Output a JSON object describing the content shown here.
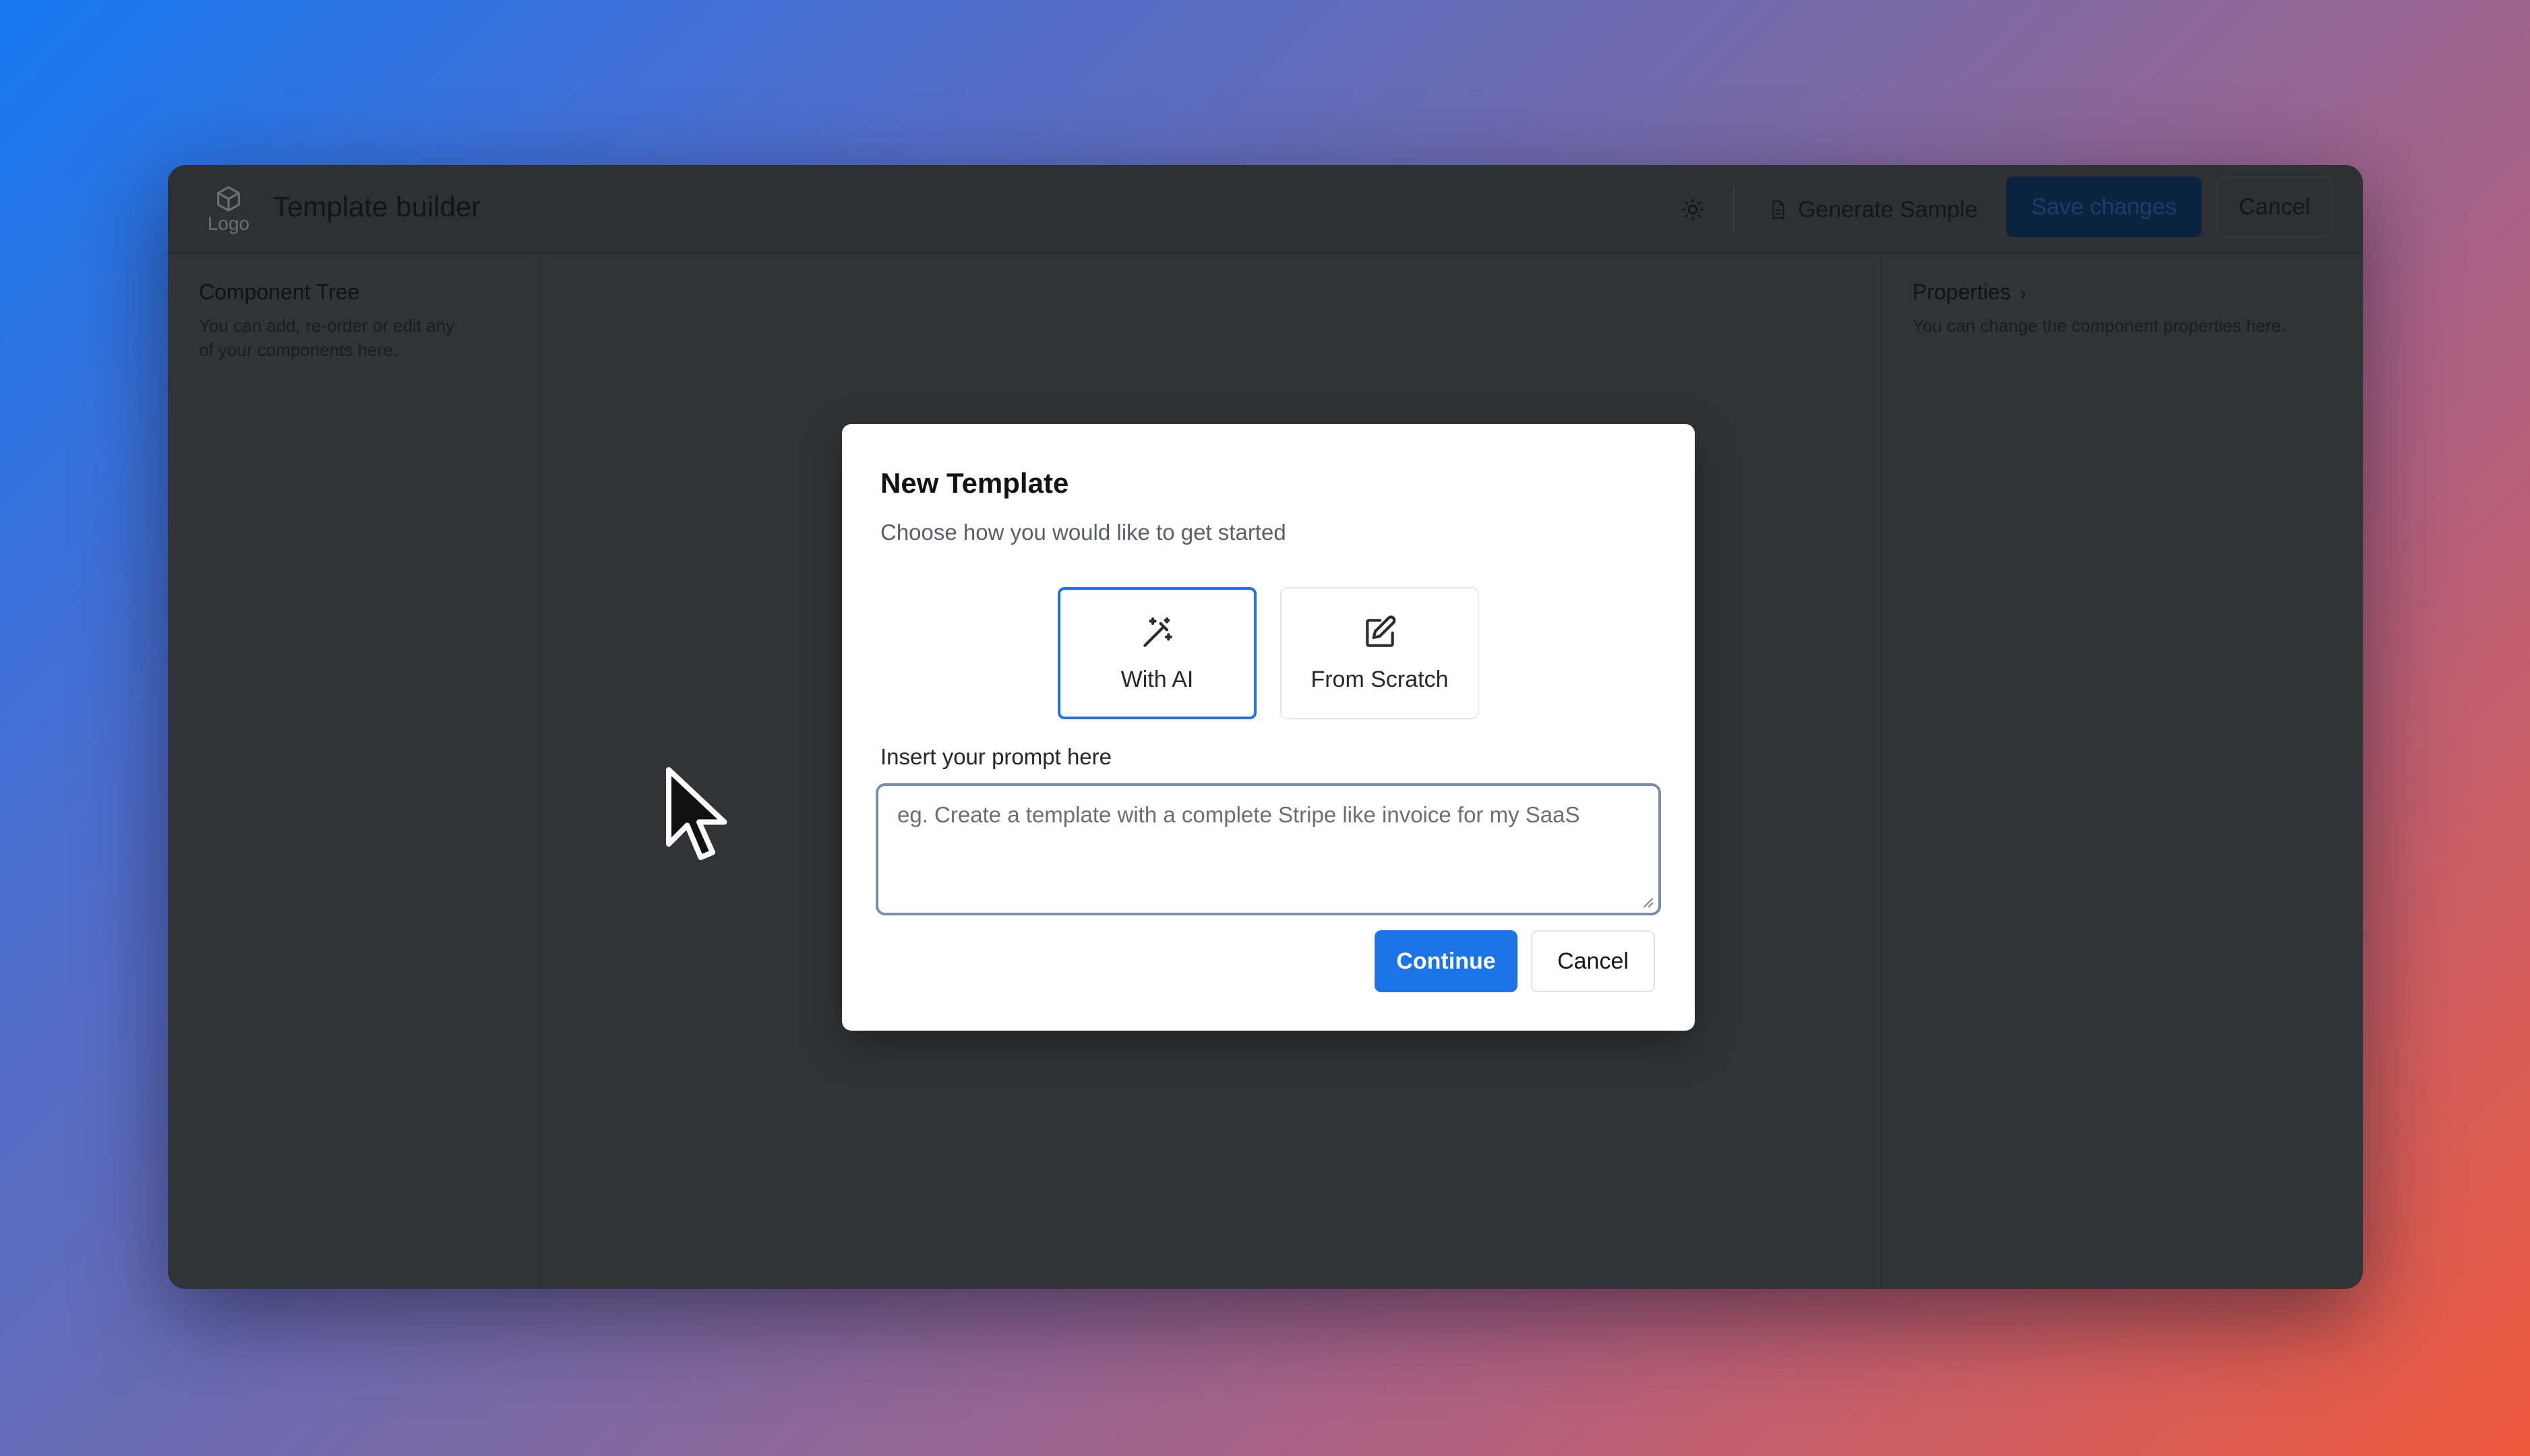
{
  "header": {
    "logo_label": "Logo",
    "title": "Template builder",
    "generate_sample_label": "Generate Sample",
    "save_label": "Save changes",
    "cancel_label": "Cancel"
  },
  "left_panel": {
    "title": "Component Tree",
    "description_line1": "You can add, re-order or edit any",
    "description_line2": "of your components here."
  },
  "right_panel": {
    "title": "Properties",
    "chevron": "›",
    "description": "You can change the component properties here."
  },
  "modal": {
    "title": "New Template",
    "subtitle": "Choose how you would like to get started",
    "options": [
      {
        "label": "With AI",
        "icon": "magic-wand-icon",
        "selected": true
      },
      {
        "label": "From Scratch",
        "icon": "edit-icon",
        "selected": false
      }
    ],
    "prompt_label": "Insert your prompt here",
    "prompt_placeholder": "eg. Create a template with a complete Stripe like invoice for my SaaS",
    "prompt_value": "",
    "continue_label": "Continue",
    "cancel_label": "Cancel"
  },
  "colors": {
    "accent": "#1c74e6",
    "overlay_dark": "#323336",
    "save_button_dimmed": "#0c2340"
  }
}
